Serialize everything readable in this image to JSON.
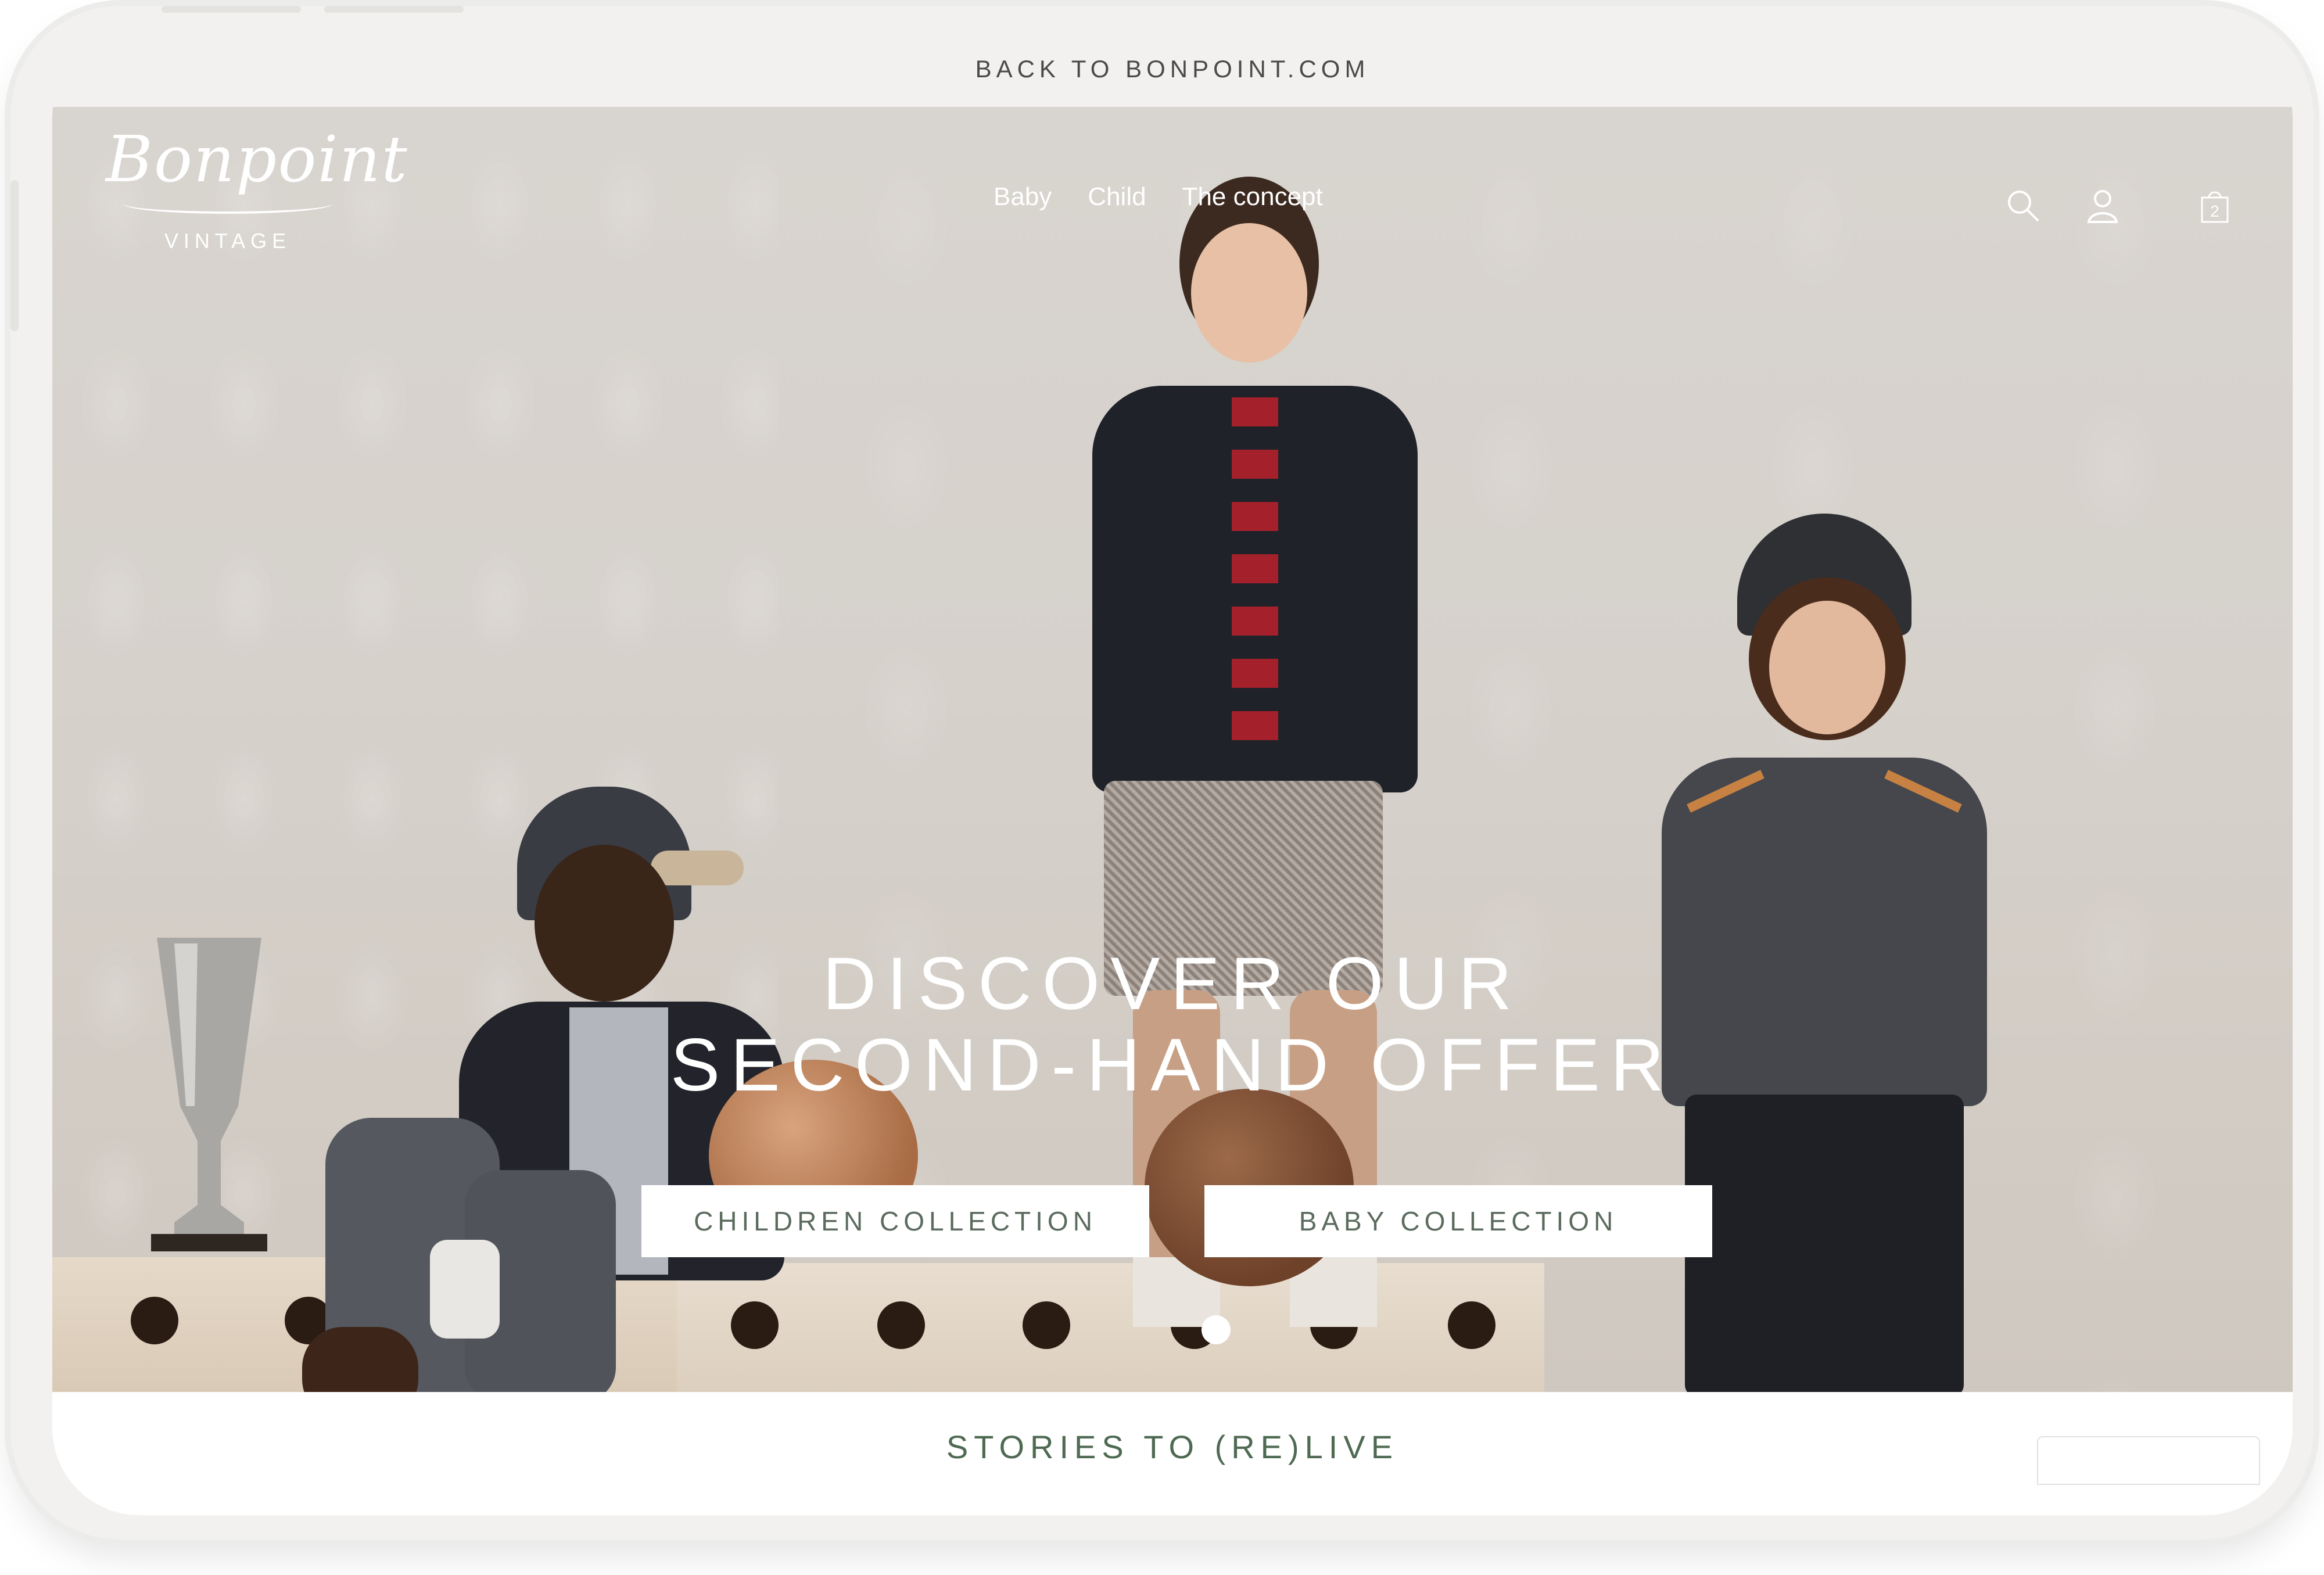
{
  "top_banner": {
    "label": "BACK TO BONPOINT.COM"
  },
  "header": {
    "logo_script": "Bonpoint",
    "logo_sub": "VINTAGE",
    "nav": [
      "Baby",
      "Child",
      "The concept"
    ],
    "cart_count": "2",
    "icons": [
      "search-icon",
      "account-icon",
      "cart-icon"
    ]
  },
  "hero": {
    "title_line1": "DISCOVER OUR",
    "title_line2": "SECOND-HAND OFFER",
    "buttons": [
      "CHILDREN COLLECTION",
      "BABY COLLECTION"
    ],
    "slide_indicator": {
      "current": 1,
      "total": 1
    }
  },
  "section": {
    "title": "STORIES TO (RE)LIVE"
  },
  "colors": {
    "banner_bg": "#f2f1ef",
    "accent_green": "#4f6a53",
    "button_text": "#5b6b5e"
  }
}
